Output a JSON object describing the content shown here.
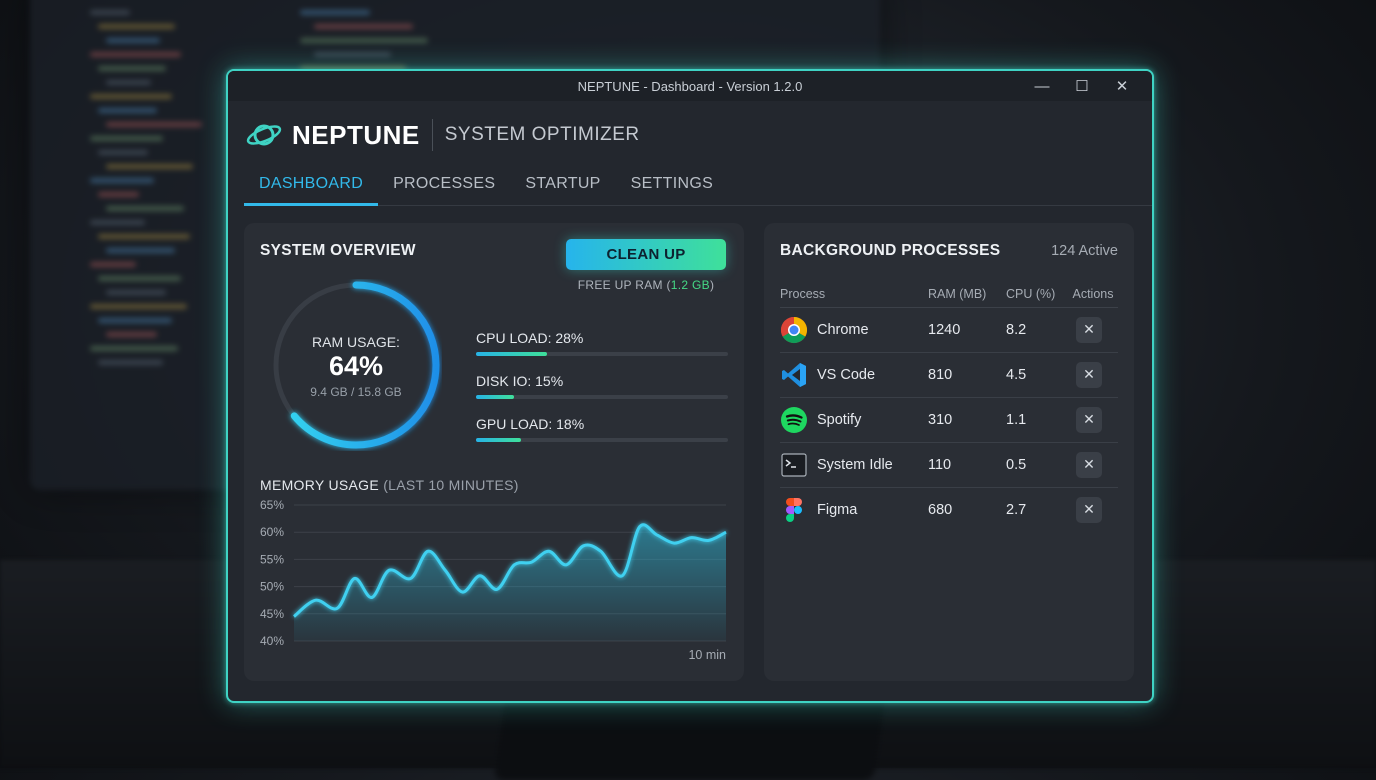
{
  "window": {
    "title": "NEPTUNE - Dashboard - Version 1.2.0",
    "controls": {
      "minimize": "—",
      "maximize": "☐",
      "close": "✕"
    }
  },
  "brand": {
    "name": "NEPTUNE",
    "subtitle": "SYSTEM OPTIMIZER",
    "logo_icon": "planet-icon",
    "accent": "#3fd3c4"
  },
  "tabs": [
    {
      "label": "DASHBOARD",
      "active": true
    },
    {
      "label": "PROCESSES",
      "active": false
    },
    {
      "label": "STARTUP",
      "active": false
    },
    {
      "label": "SETTINGS",
      "active": false
    }
  ],
  "overview": {
    "title": "SYSTEM OVERVIEW",
    "cleanup_label": "CLEAN UP",
    "free_up_prefix": "FREE UP RAM (",
    "free_up_amount": "1.2 GB",
    "free_up_suffix": ")",
    "ram": {
      "label": "RAM USAGE:",
      "percent_text": "64%",
      "percent": 0.64,
      "detail": "9.4 GB / 15.8 GB"
    },
    "metrics": [
      {
        "label": "CPU LOAD: 28%",
        "value": 0.28
      },
      {
        "label": "DISK IO: 15%",
        "value": 0.15
      },
      {
        "label": "GPU LOAD: 18%",
        "value": 0.18
      }
    ],
    "memory_title": "MEMORY USAGE",
    "memory_subtitle": "(LAST 10 MINUTES)"
  },
  "chart_data": {
    "type": "area",
    "title": "MEMORY USAGE (LAST 10 MINUTES)",
    "xlabel": "10 min",
    "ylabel": "",
    "yticks": [
      "40%",
      "45%",
      "50%",
      "55%",
      "60%",
      "65%"
    ],
    "ylim": [
      40,
      65
    ],
    "grid": true,
    "x": [
      0,
      0.5,
      1,
      1.4,
      1.8,
      2.2,
      2.7,
      3.1,
      3.5,
      3.9,
      4.3,
      4.7,
      5.1,
      5.5,
      5.9,
      6.3,
      6.7,
      7.1,
      7.6,
      8.0,
      8.4,
      8.8,
      9.2,
      9.6,
      10
    ],
    "values": [
      44.5,
      47.5,
      46.0,
      51.5,
      48.0,
      53.0,
      51.5,
      56.5,
      53.0,
      49.0,
      52.0,
      49.5,
      54.0,
      54.5,
      56.5,
      54.0,
      57.5,
      56.5,
      52.0,
      61.0,
      59.5,
      58.0,
      59.0,
      58.5,
      60.0
    ]
  },
  "processes": {
    "title": "BACKGROUND PROCESSES",
    "active_count": "124 Active",
    "columns": [
      "Process",
      "RAM (MB)",
      "CPU (%)",
      "Actions"
    ],
    "rows": [
      {
        "name": "Chrome",
        "ram": "1240",
        "cpu": "8.2",
        "icon": "chrome-icon"
      },
      {
        "name": "VS Code",
        "ram": "810",
        "cpu": "4.5",
        "icon": "vscode-icon"
      },
      {
        "name": "Spotify",
        "ram": "310",
        "cpu": "1.1",
        "icon": "spotify-icon"
      },
      {
        "name": "System Idle",
        "ram": "110",
        "cpu": "0.5",
        "icon": "terminal-icon"
      },
      {
        "name": "Figma",
        "ram": "680",
        "cpu": "2.7",
        "icon": "figma-icon"
      }
    ],
    "kill_label": "✕"
  },
  "colors": {
    "accent_blue": "#32b9ea",
    "accent_green": "#3fe09a",
    "panel": "#2a2e35",
    "window": "#23272e"
  }
}
